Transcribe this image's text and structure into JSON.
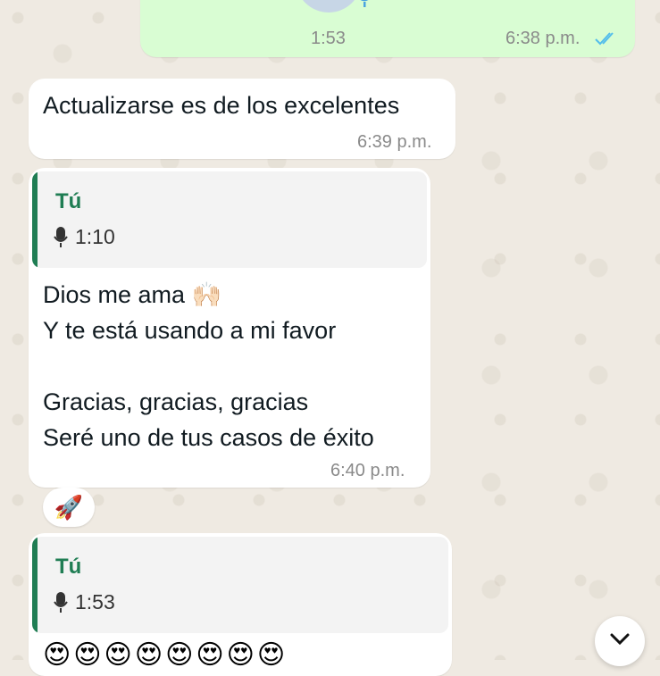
{
  "colors": {
    "background": "#efeae2",
    "incoming_bubble": "#ffffff",
    "outgoing_bubble": "#d9fdd3",
    "quote_accent": "#1f7d53",
    "read_ticks": "#53bdeb"
  },
  "outgoing_voice": {
    "duration": "1:53",
    "time": "6:38 p.m.",
    "status_icon": "double-check-read"
  },
  "message1": {
    "text": "Actualizarse es de los excelentes",
    "time": "6:39 p.m."
  },
  "message2": {
    "quote_sender": "Tú",
    "quote_duration": "1:10",
    "text": "Dios me ama 🙌🏻\nY te está usando a mi favor\n\nGracias, gracias, gracias\nSeré uno de tus casos de éxito",
    "time": "6:40 p.m.",
    "reaction": "🚀"
  },
  "message3": {
    "quote_sender": "Tú",
    "quote_duration": "1:53",
    "text": "😍😍😍😍😍😍😍😍"
  },
  "scroll_down_icon": "chevron-down-icon"
}
